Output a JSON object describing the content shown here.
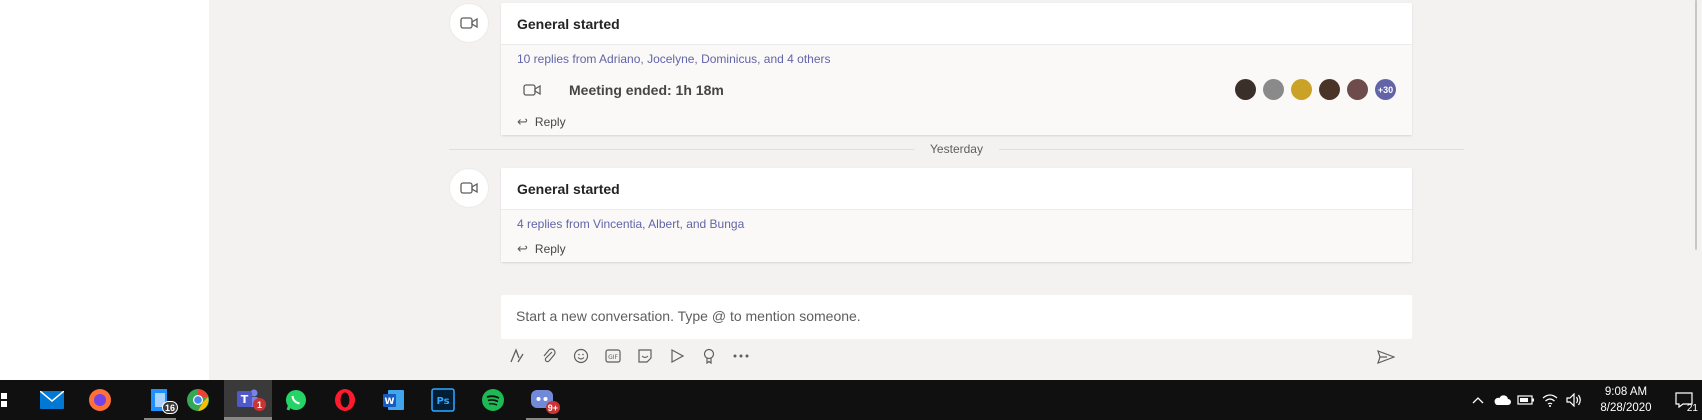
{
  "threads": [
    {
      "title": "General started",
      "replies": "10 replies from Adriano, Jocelyne, Dominicus, and 4 others",
      "meeting_label": "Meeting ended: 1h 18m",
      "avatar_colors": [
        "#3b2f2a",
        "#8a8a8a",
        "#c9a227",
        "#4a3428",
        "#6e4c4c"
      ],
      "more_count": "+30",
      "reply_label": "Reply"
    },
    {
      "title": "General started",
      "replies": "4 replies from Vincentia, Albert, and Bunga",
      "reply_label": "Reply"
    }
  ],
  "divider": {
    "label": "Yesterday"
  },
  "compose": {
    "placeholder": "Start a new conversation. Type @ to mention someone."
  },
  "toolbar_icons": [
    "format-icon",
    "attach-icon",
    "emoji-icon",
    "gif-icon",
    "sticker-icon",
    "meet-now-icon",
    "praise-icon",
    "more-options-icon",
    "send-icon"
  ],
  "taskbar": {
    "apps": [
      {
        "name": "mail-app-icon",
        "color": "#0078d4"
      },
      {
        "name": "firefox-app-icon",
        "color": "#ff7139"
      },
      {
        "name": "files-app-icon",
        "color": "#1e90ff",
        "badge": "16"
      },
      {
        "name": "chrome-app-icon",
        "color": "#34a853"
      },
      {
        "name": "teams-app-icon",
        "color": "#6264a7",
        "badge": "1"
      },
      {
        "name": "whatsapp-app-icon",
        "color": "#25d366"
      },
      {
        "name": "opera-app-icon",
        "color": "#ff1b2d"
      },
      {
        "name": "word-app-icon",
        "color": "#2b579a"
      },
      {
        "name": "photoshop-app-icon",
        "color": "#31a8ff"
      },
      {
        "name": "spotify-app-icon",
        "color": "#1db954"
      },
      {
        "name": "discord-app-icon",
        "color": "#7289da",
        "badge": "9+"
      }
    ],
    "time": "9:08 AM",
    "date": "8/28/2020",
    "notification_count": "21"
  }
}
